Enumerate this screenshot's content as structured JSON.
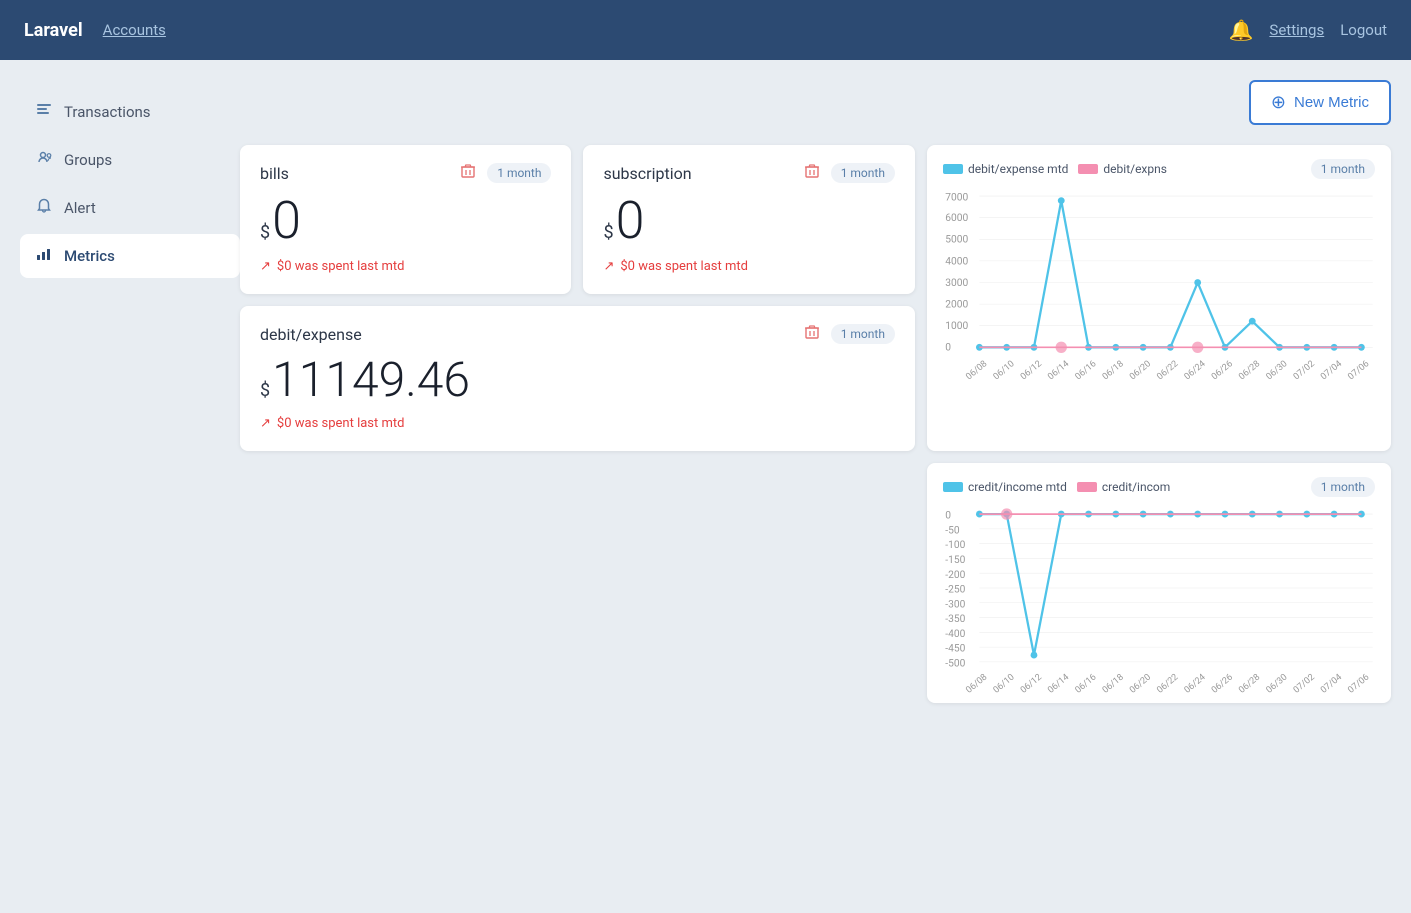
{
  "header": {
    "brand": "Laravel",
    "accounts_label": "Accounts",
    "settings_label": "Settings",
    "logout_label": "Logout"
  },
  "new_metric_button": "New Metric",
  "sidebar": {
    "items": [
      {
        "id": "transactions",
        "label": "Transactions",
        "icon": "🗂"
      },
      {
        "id": "groups",
        "label": "Groups",
        "icon": "🏷"
      },
      {
        "id": "alert",
        "label": "Alert",
        "icon": "🔔"
      },
      {
        "id": "metrics",
        "label": "Metrics",
        "icon": "📊",
        "active": true
      }
    ]
  },
  "metrics": [
    {
      "id": "bills",
      "title": "bills",
      "period": "1 month",
      "currency": "$",
      "value": "0",
      "footer": "$0 was spent last mtd",
      "has_delete": true
    },
    {
      "id": "subscription",
      "title": "subscription",
      "period": "1 month",
      "currency": "$",
      "value": "0",
      "footer": "$0 was spent last mtd",
      "has_delete": true
    },
    {
      "id": "debit_expense",
      "title": "debit/expense",
      "period": "1 month",
      "currency": "$",
      "value": "11149.46",
      "footer": "$0 was spent last mtd",
      "has_delete": true,
      "wide": true
    }
  ],
  "charts": [
    {
      "id": "debit_expense_chart",
      "legend1_color": "#4fc3e8",
      "legend1_label": "debit/expense mtd",
      "legend2_color": "#f48fb1",
      "legend2_label": "debit/expns",
      "period": "1 month",
      "x_labels": [
        "06/08",
        "06/10",
        "06/12",
        "06/14",
        "06/16",
        "06/18",
        "06/20",
        "06/22",
        "06/24",
        "06/26",
        "06/28",
        "06/30",
        "07/02",
        "07/04",
        "07/06"
      ],
      "y_labels": [
        "7000",
        "6000",
        "5000",
        "4000",
        "3000",
        "2000",
        "1000",
        "0"
      ]
    },
    {
      "id": "credit_income_chart",
      "legend1_color": "#4fc3e8",
      "legend1_label": "credit/income mtd",
      "legend2_color": "#f48fb1",
      "legend2_label": "credit/incom",
      "period": "1 month",
      "x_labels": [
        "06/08",
        "06/10",
        "06/12",
        "06/14",
        "06/16",
        "06/18",
        "06/20",
        "06/22",
        "06/24",
        "06/26",
        "06/28",
        "06/30",
        "07/02",
        "07/04",
        "07/06"
      ],
      "y_labels": [
        "0",
        "-50",
        "-100",
        "-150",
        "-200",
        "-250",
        "-300",
        "-350",
        "-400",
        "-450",
        "-500"
      ]
    }
  ]
}
